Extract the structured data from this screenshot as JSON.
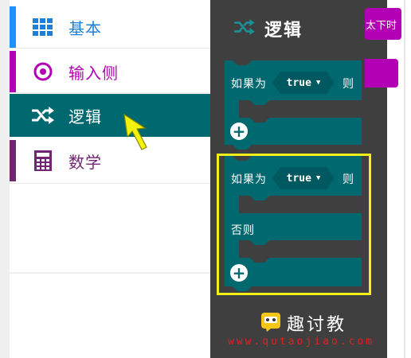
{
  "toolbox": {
    "categories": [
      {
        "label": "基本",
        "icon": "grid-icon",
        "color": "#1e90ff"
      },
      {
        "label": "输入侧",
        "icon": "target-icon",
        "color": "#b400b4"
      },
      {
        "label": "逻辑",
        "icon": "shuffle-icon",
        "color": "#006970",
        "selected": true
      },
      {
        "label": "数学",
        "icon": "calculator-icon",
        "color": "#712672"
      }
    ]
  },
  "flyout": {
    "title": "逻辑",
    "title_icon": "shuffle-icon",
    "block1": {
      "if_label": "如果为",
      "value": "true",
      "then_label": "则"
    },
    "block2": {
      "if_label": "如果为",
      "value": "true",
      "then_label": "则",
      "else_label": "否则"
    }
  },
  "workspace": {
    "partial_block_text": "太下时"
  },
  "watermark": {
    "brand": "趣讨教",
    "url": "www.qutaojiao.com"
  },
  "colors": {
    "logic": "#006970",
    "flyout_bg": "#3f3f3f",
    "highlight": "#f6ef1a",
    "cursor": "#f2f20a"
  }
}
